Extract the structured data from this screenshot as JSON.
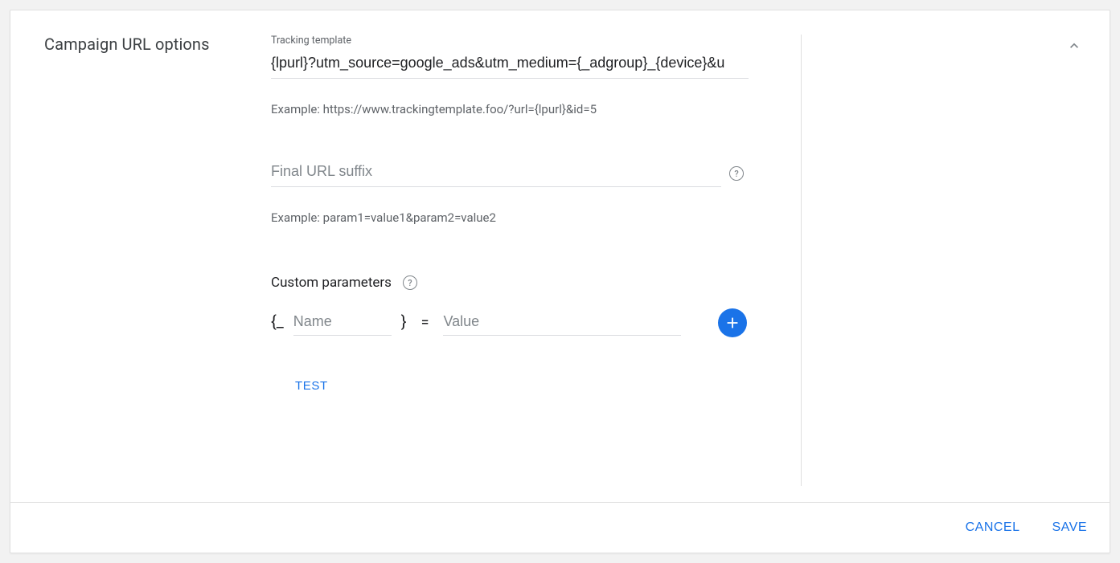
{
  "section": {
    "title": "Campaign URL options"
  },
  "tracking": {
    "label": "Tracking template",
    "value": "{lpurl}?utm_source=google_ads&utm_medium={_adgroup}_{device}&u",
    "example": "Example: https://www.trackingtemplate.foo/?url={lpurl}&id=5"
  },
  "suffix": {
    "placeholder": "Final URL suffix",
    "example": "Example: param1=value1&param2=value2"
  },
  "custom": {
    "title": "Custom parameters",
    "brace_open": "{_",
    "brace_close": "}",
    "equals": "=",
    "name_placeholder": "Name",
    "value_placeholder": "Value"
  },
  "buttons": {
    "test": "TEST",
    "cancel": "CANCEL",
    "save": "SAVE"
  }
}
